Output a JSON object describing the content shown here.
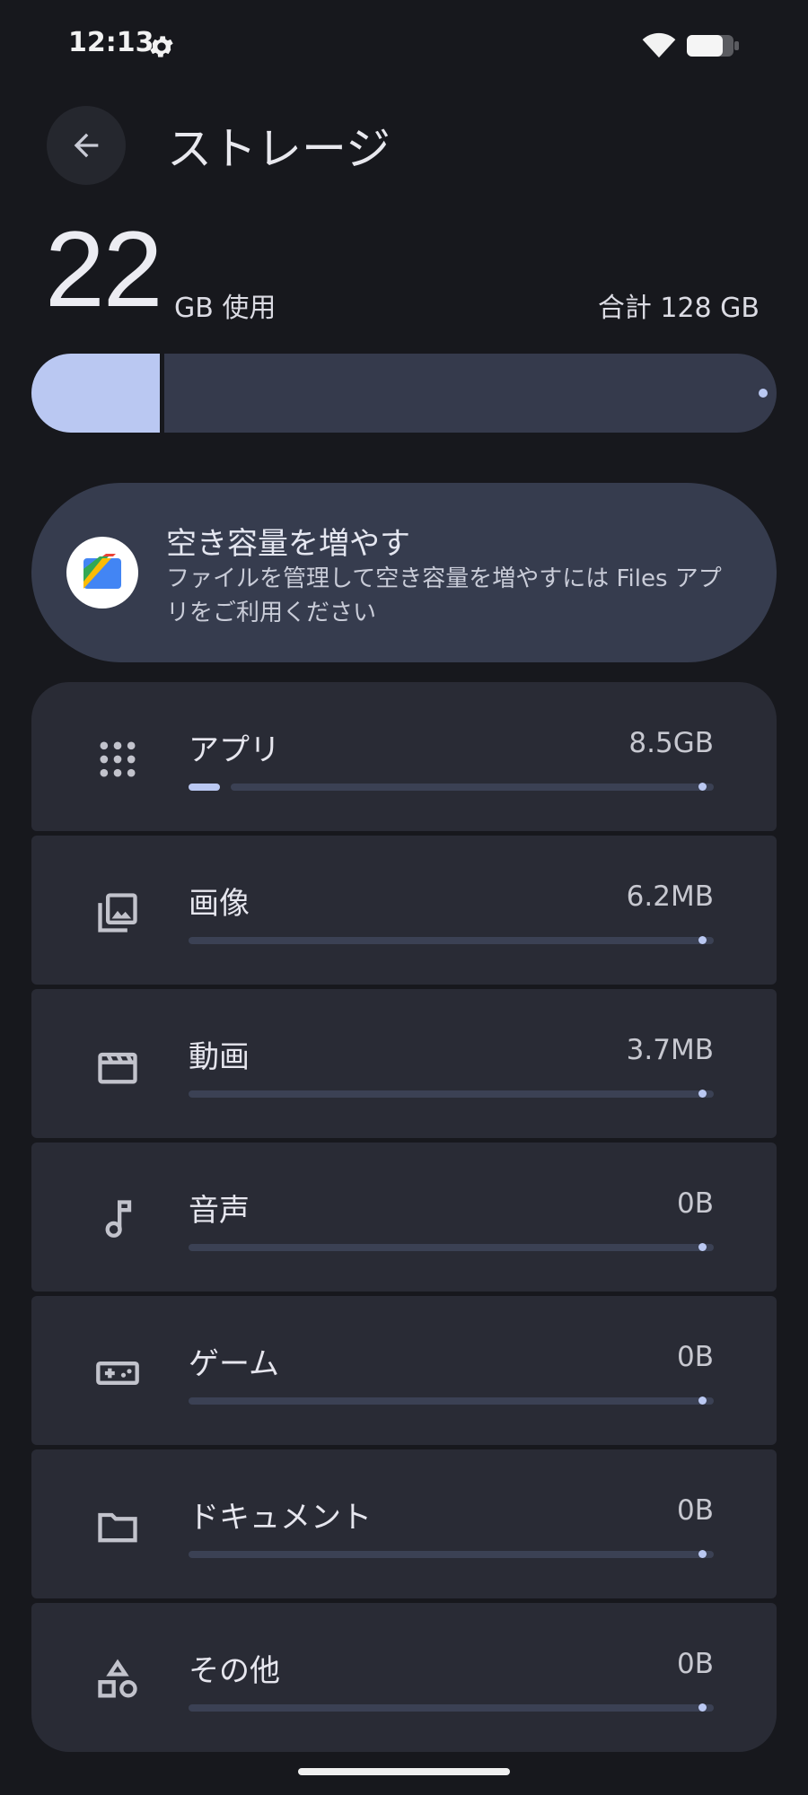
{
  "status_bar": {
    "time": "12:13"
  },
  "header": {
    "title": "ストレージ"
  },
  "summary": {
    "used_value": "22",
    "used_unit": "GB 使用",
    "total_label": "合計 128 GB",
    "used_fraction": 0.172
  },
  "files_card": {
    "title": "空き容量を増やす",
    "description": "ファイルを管理して空き容量を増やすには Files アプリをご利用ください"
  },
  "categories": [
    {
      "label": "アプリ",
      "size": "8.5GB",
      "fraction": 0.06,
      "icon": "apps-grid-icon"
    },
    {
      "label": "画像",
      "size": "6.2MB",
      "fraction": 0,
      "icon": "images-icon"
    },
    {
      "label": "動画",
      "size": "3.7MB",
      "fraction": 0,
      "icon": "video-icon"
    },
    {
      "label": "音声",
      "size": "0B",
      "fraction": 0,
      "icon": "music-note-icon"
    },
    {
      "label": "ゲーム",
      "size": "0B",
      "fraction": 0,
      "icon": "gamepad-icon"
    },
    {
      "label": "ドキュメント",
      "size": "0B",
      "fraction": 0,
      "icon": "folder-icon"
    },
    {
      "label": "その他",
      "size": "0B",
      "fraction": 0,
      "icon": "shapes-icon"
    }
  ],
  "colors": {
    "background": "#17181d",
    "accent": "#bac8f2",
    "track": "#353a4c",
    "card": "#292b35"
  }
}
